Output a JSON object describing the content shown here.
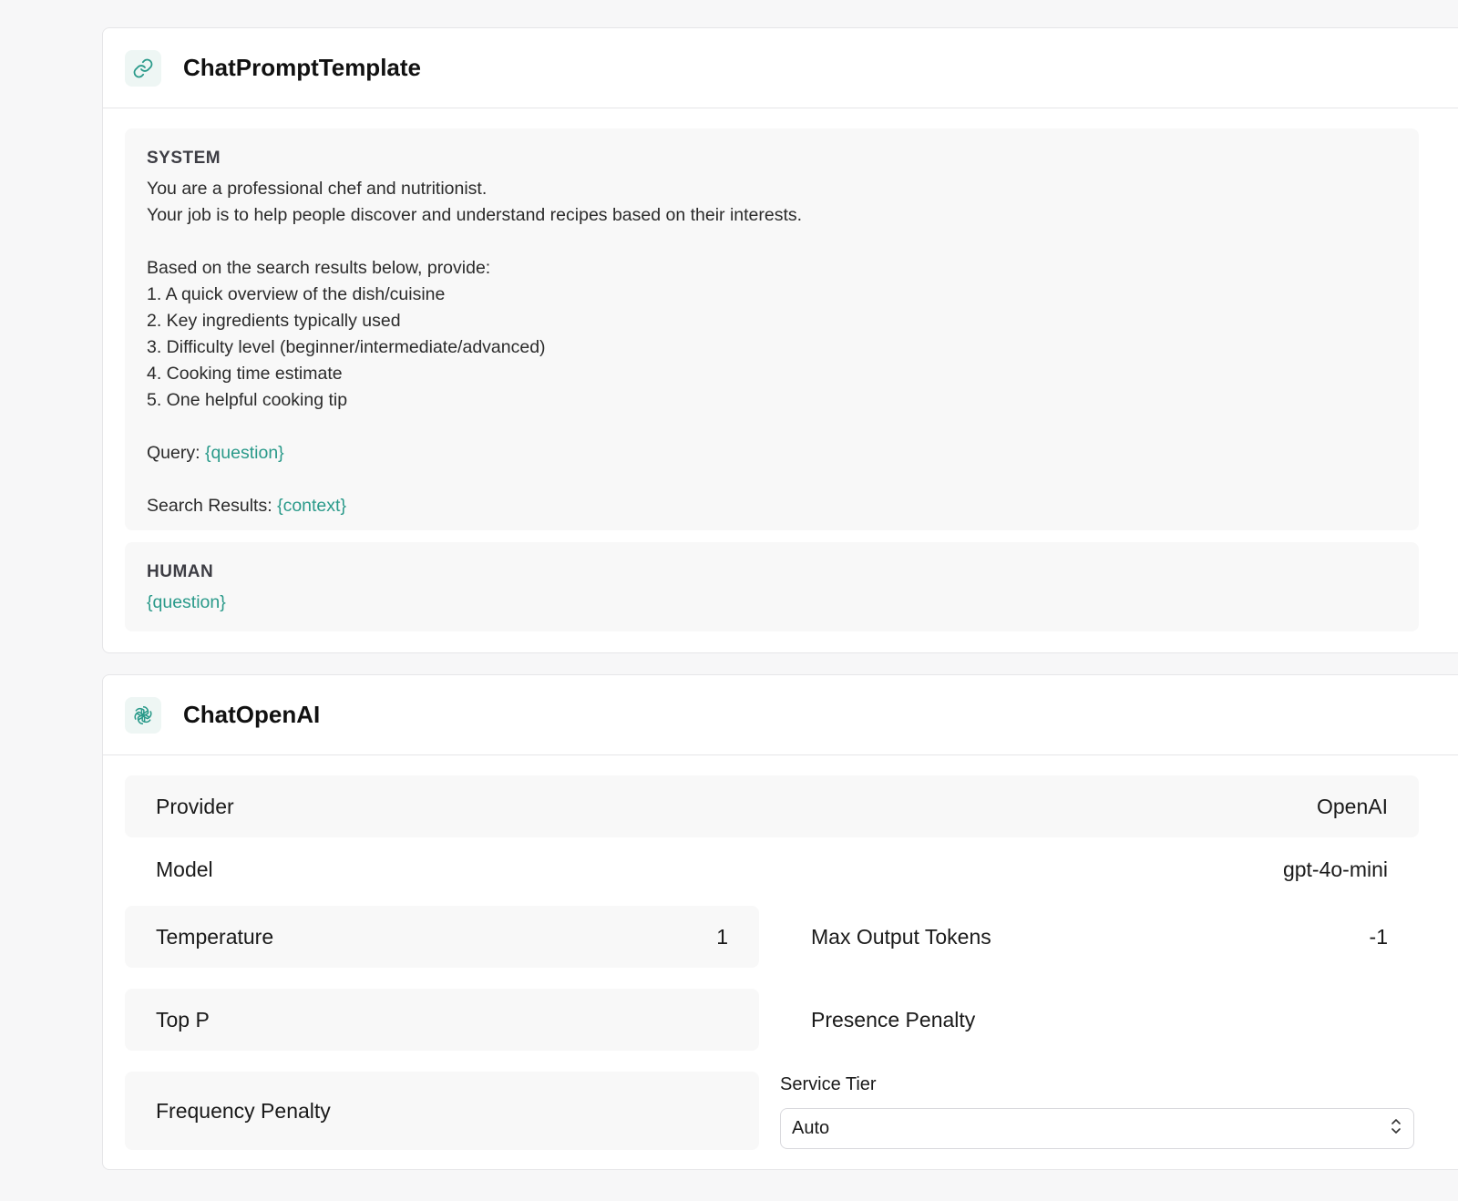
{
  "prompt_card": {
    "title": "ChatPromptTemplate",
    "icon": "link-icon",
    "system": {
      "role": "SYSTEM",
      "lines": [
        {
          "text": "You are a professional chef and nutritionist.",
          "var": ""
        },
        {
          "text": "Your job is to help people discover and understand recipes based on their interests.",
          "var": ""
        },
        {
          "text": "",
          "var": ""
        },
        {
          "text": "Based on the search results below, provide:",
          "var": ""
        },
        {
          "text": "1. A quick overview of the dish/cuisine",
          "var": ""
        },
        {
          "text": "2. Key ingredients typically used",
          "var": ""
        },
        {
          "text": "3. Difficulty level (beginner/intermediate/advanced)",
          "var": ""
        },
        {
          "text": "4. Cooking time estimate",
          "var": ""
        },
        {
          "text": "5. One helpful cooking tip",
          "var": ""
        },
        {
          "text": "",
          "var": ""
        },
        {
          "text": "Query: ",
          "var": "{question}"
        },
        {
          "text": "",
          "var": ""
        },
        {
          "text": "Search Results: ",
          "var": "{context}"
        }
      ]
    },
    "human": {
      "role": "HUMAN",
      "var": "{question}"
    }
  },
  "model_card": {
    "title": "ChatOpenAI",
    "icon": "openai-icon",
    "provider": {
      "label": "Provider",
      "value": "OpenAI"
    },
    "model": {
      "label": "Model",
      "value": "gpt-4o-mini"
    },
    "temperature": {
      "label": "Temperature",
      "value": "1"
    },
    "max_output_tokens": {
      "label": "Max Output Tokens",
      "value": "-1"
    },
    "top_p": {
      "label": "Top P",
      "value": ""
    },
    "presence_penalty": {
      "label": "Presence Penalty",
      "value": ""
    },
    "frequency_penalty": {
      "label": "Frequency Penalty",
      "value": ""
    },
    "service_tier": {
      "label": "Service Tier",
      "value": "Auto"
    }
  },
  "colors": {
    "accent": "#2a9a8a",
    "panel": "#f8f8f8",
    "border": "#e6e6e8"
  }
}
